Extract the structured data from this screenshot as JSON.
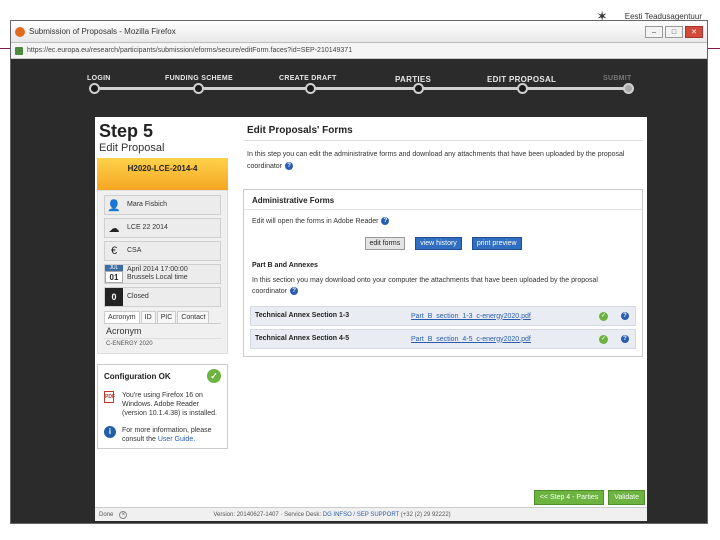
{
  "brand": {
    "name": "Eesti Teadusagentuur"
  },
  "window": {
    "title": "Submission of Proposals - Mozilla Firefox",
    "url": "https://ec.europa.eu/research/participants/submission/eforms/secure/editForm.faces?id=SEP-210149371"
  },
  "steps": [
    {
      "label": "LOGIN"
    },
    {
      "label": "FUNDING SCHEME"
    },
    {
      "label": "CREATE DRAFT"
    },
    {
      "label": "PARTIES"
    },
    {
      "label": "EDIT PROPOSAL"
    },
    {
      "label": "SUBMIT"
    }
  ],
  "left": {
    "step_title": "Step 5",
    "step_sub": "Edit Proposal",
    "call_id": "H2020-LCE-2014-4",
    "info": {
      "person": "Mara Fisbich",
      "topic": "LCE 22 2014",
      "type": "CSA",
      "date_month": "JUL",
      "date_day": "01",
      "deadline": "April 2014 17:00:00",
      "deadline_sub": "Brussels Local time",
      "status_count": "0",
      "status": "Closed"
    },
    "tabs": [
      "Acronym",
      "ID",
      "PIC",
      "Contact"
    ],
    "acronym_label": "Acronym",
    "acronym_value": "C-ENERGY 2020",
    "config": {
      "title": "Configuration OK",
      "firefox_text": "You're using Firefox 16 on Windows. Adobe Reader (version 10.1.4.38) is installed.",
      "info_text": "For more information, please consult the",
      "info_link": "User Guide."
    }
  },
  "right": {
    "title": "Edit Proposals' Forms",
    "intro": "In this step you can edit the administrative forms and download any attachments that have been uploaded by the proposal coordinator",
    "admin_title": "Administrative Forms",
    "admin_text": "Edit will open the forms in Adobe Reader",
    "buttons": {
      "edit": "edit forms",
      "history": "view history",
      "preview": "print preview"
    },
    "part_b_title": "Part B and Annexes",
    "part_b_text": "In this section you may download onto your computer the attachments that have been uploaded by the proposal coordinator",
    "annexes": [
      {
        "name": "Technical Annex Section 1-3",
        "file": "Part_B_section_1-3_c-energy2020.pdf"
      },
      {
        "name": "Technical Annex Section 4-5",
        "file": "Part_B_section_4-5_c-energy2020.pdf"
      }
    ]
  },
  "bottom": {
    "prev": "<< Step 4 - Parties",
    "validate": "Validate"
  },
  "status_bar": {
    "done": "Done",
    "version": "Version: 20140627-1407 · Service Desk:",
    "link": "DG INFSO / SEP SUPPORT",
    "contact": "(+32 (2) 29 92222)"
  }
}
